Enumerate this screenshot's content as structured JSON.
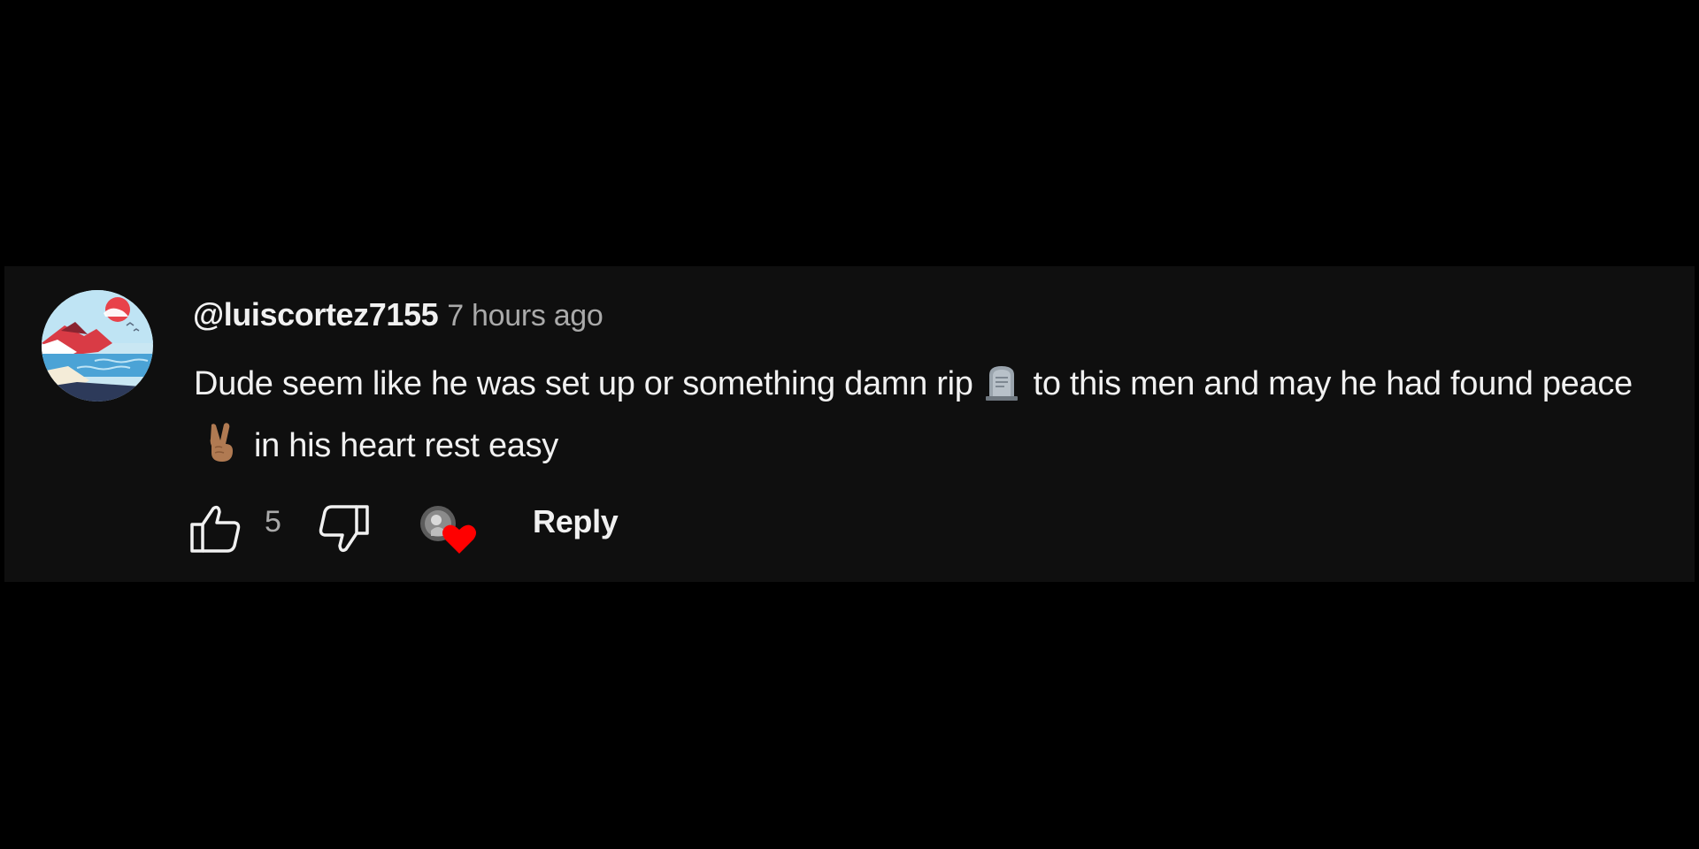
{
  "comment": {
    "author": "@luiscortez7155",
    "timestamp": "7 hours ago",
    "text_part1": "Dude seem like he was set up or something damn rip",
    "text_part2": "to this men and may he had found peace",
    "text_part3": "in his heart rest easy",
    "emoji_1": "headstone",
    "emoji_2": "victory-hand-medium-skin-tone"
  },
  "actions": {
    "like_count": "5",
    "reply_label": "Reply",
    "hearted_by_creator": true
  },
  "colors": {
    "background": "#000000",
    "card": "#0f0f0f",
    "text_primary": "#f1f1f1",
    "text_secondary": "#aaaaaa",
    "heart": "#ff0000"
  },
  "icons": {
    "like": "thumbs-up-icon",
    "dislike": "thumbs-down-icon",
    "heart": "creator-heart-icon"
  }
}
